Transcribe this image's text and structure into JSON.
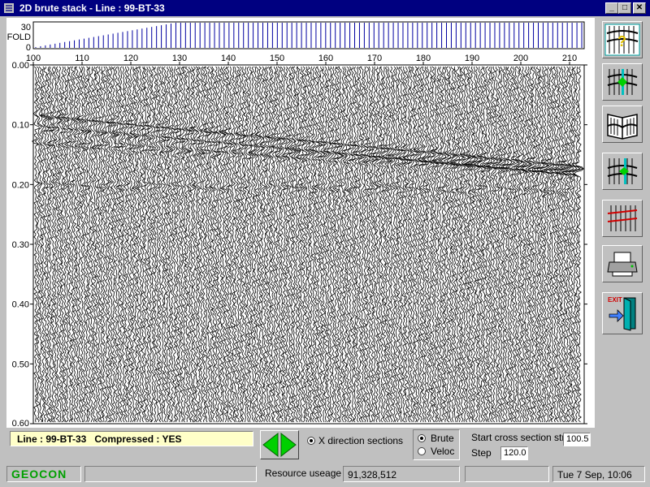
{
  "window": {
    "title": "2D brute stack - Line : 99-BT-33",
    "minimize": "_",
    "maximize": "□",
    "close": "✕"
  },
  "fold": {
    "label": "FOLD",
    "ymax": "30",
    "ymin": "0",
    "values": [
      1,
      2,
      3,
      4,
      5,
      6,
      7,
      8,
      9,
      10,
      11,
      12,
      13,
      14,
      15,
      16,
      17,
      18,
      19,
      20,
      21,
      22,
      23,
      24,
      25,
      26,
      27,
      28,
      29,
      30,
      30,
      30,
      30,
      30,
      30,
      30,
      30,
      30,
      30,
      30,
      30,
      30,
      30,
      30,
      30,
      30,
      30,
      30,
      30,
      30,
      30,
      30,
      30,
      30,
      30,
      30,
      30,
      30,
      30,
      30,
      30,
      30,
      30,
      30,
      30,
      30,
      30,
      30,
      30,
      30,
      30,
      30,
      30,
      30,
      30,
      30,
      30,
      30,
      30,
      30,
      30,
      30,
      30,
      30,
      30,
      30,
      30,
      30,
      30,
      30,
      30,
      30,
      30,
      30,
      30,
      30,
      30,
      30,
      30,
      30,
      30,
      30,
      30,
      30,
      30,
      30,
      30,
      30,
      30,
      30,
      30,
      30,
      30,
      30
    ]
  },
  "section": {
    "x_ticks": [
      "100",
      "110",
      "120",
      "130",
      "140",
      "150",
      "160",
      "170",
      "180",
      "190",
      "200",
      "210"
    ],
    "y_ticks": [
      "0.00",
      "0.10",
      "0.20",
      "0.30",
      "0.40",
      "0.50",
      "0.60"
    ],
    "x_range": [
      100,
      213
    ],
    "y_range": [
      0.0,
      0.6
    ]
  },
  "toolbar": {
    "icons": [
      "help-section-icon",
      "pick-velocity-icon",
      "book-icon",
      "select-trace-icon",
      "trace-view-icon",
      "printer-icon",
      "exit-door-icon"
    ],
    "exit_label": "EXIT"
  },
  "status": {
    "line_text": "Line : 99-BT-33   Compressed : YES"
  },
  "options": {
    "x_direction_label": "X direction sections",
    "brute_label": "Brute",
    "veloc_label": "Veloc",
    "start_label": "Start cross section stn",
    "start_value": "100.5",
    "step_label": "Step",
    "step_value": "120.0"
  },
  "footer": {
    "logo": "GEOCON",
    "resource_label": "Resource useage",
    "resource_value": "91,328,512",
    "datetime": "Tue 7 Sep, 10:06"
  }
}
